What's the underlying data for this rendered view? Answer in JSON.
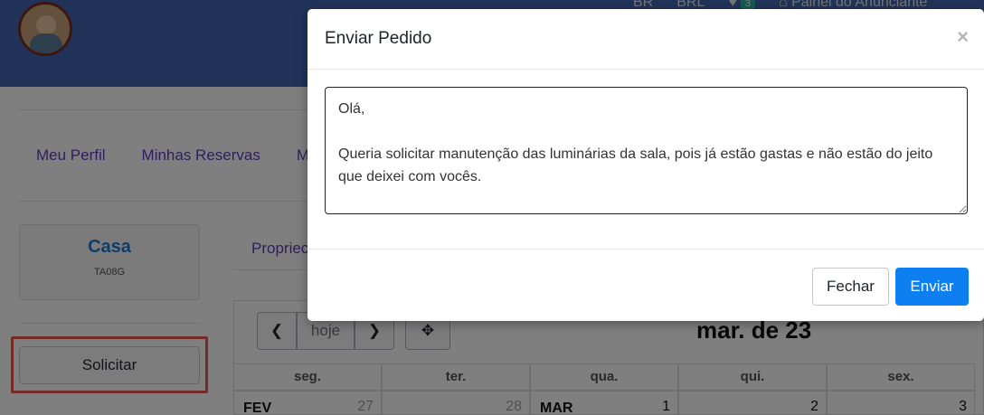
{
  "topbar": {
    "nav_items": [
      "BR",
      "BRL"
    ],
    "badge_count": "3",
    "advertiser_panel": "Painel do Anunciante"
  },
  "menu": {
    "items": [
      "Meu Perfil",
      "Minhas Reservas",
      "M"
    ]
  },
  "property": {
    "name": "Casa",
    "code": "TA08G",
    "request_button": "Solicitar",
    "tab_label": "Propriec"
  },
  "calendar": {
    "today_label": "hoje",
    "title": "mar. de 23",
    "weekdays": [
      "seg.",
      "ter.",
      "qua.",
      "qui.",
      "sex."
    ],
    "first_row": [
      {
        "month": "FEV",
        "day": "27"
      },
      {
        "month": "",
        "day": "28"
      },
      {
        "month": "MAR",
        "day": "1"
      },
      {
        "month": "",
        "day": "2"
      },
      {
        "month": "",
        "day": "3"
      }
    ]
  },
  "modal": {
    "title": "Enviar Pedido",
    "close_symbol": "×",
    "message": "Olá,\n\nQueria solicitar manutenção das luminárias da sala, pois já estão gastas e não estão do jeito que deixei com vocês.",
    "close_button": "Fechar",
    "send_button": "Enviar"
  },
  "colors": {
    "topbar": "#4267b2",
    "primary_button": "#0d7ff0",
    "highlight_frame": "#e8544b",
    "link": "#5b3fbd",
    "property_title": "#1f78d1"
  },
  "icons": [
    "close-icon",
    "chevron-left-icon",
    "chevron-right-icon",
    "move-icon",
    "home-icon",
    "resize-handle-icon"
  ]
}
